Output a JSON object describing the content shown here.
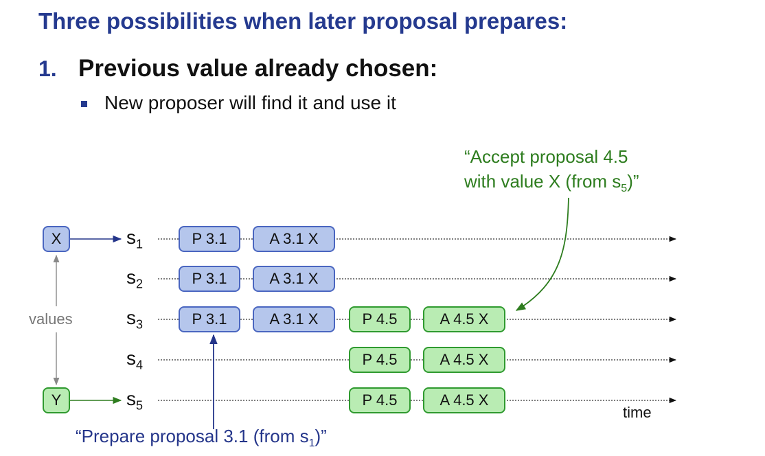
{
  "slide": {
    "title": "Three possibilities when later proposal prepares:",
    "item_number": "1.",
    "heading": "Previous value already chosen:",
    "bullet": "New proposer will find it and use it"
  },
  "diagram": {
    "value_top": "X",
    "value_bottom": "Y",
    "values_label": "values",
    "time_label": "time",
    "servers": [
      {
        "name": "s",
        "sub": "1"
      },
      {
        "name": "s",
        "sub": "2"
      },
      {
        "name": "s",
        "sub": "3"
      },
      {
        "name": "s",
        "sub": "4"
      },
      {
        "name": "s",
        "sub": "5"
      }
    ],
    "rows": [
      {
        "prepare_old": "P 3.1",
        "accept_old": "A 3.1 X"
      },
      {
        "prepare_old": "P 3.1",
        "accept_old": "A 3.1 X"
      },
      {
        "prepare_old": "P 3.1",
        "accept_old": "A 3.1 X",
        "prepare_new": "P 4.5",
        "accept_new": "A 4.5 X"
      },
      {
        "prepare_new": "P 4.5",
        "accept_new": "A 4.5 X"
      },
      {
        "prepare_new": "P 4.5",
        "accept_new": "A 4.5 X"
      }
    ],
    "annotation_accept": {
      "line1": "“Accept proposal 4.5",
      "line2_pre": "with value X (from s",
      "line2_sub": "5",
      "line2_post": ")”"
    },
    "annotation_prepare": {
      "pre": "“Prepare proposal 3.1 (from s",
      "sub": "1",
      "post": ")”"
    },
    "colors": {
      "title_blue": "#253a8f",
      "box_blue": "#b5c6ec",
      "box_green": "#b9ecb3",
      "annotation_green": "#2e7d1f",
      "annotation_blue": "#24358a"
    }
  }
}
